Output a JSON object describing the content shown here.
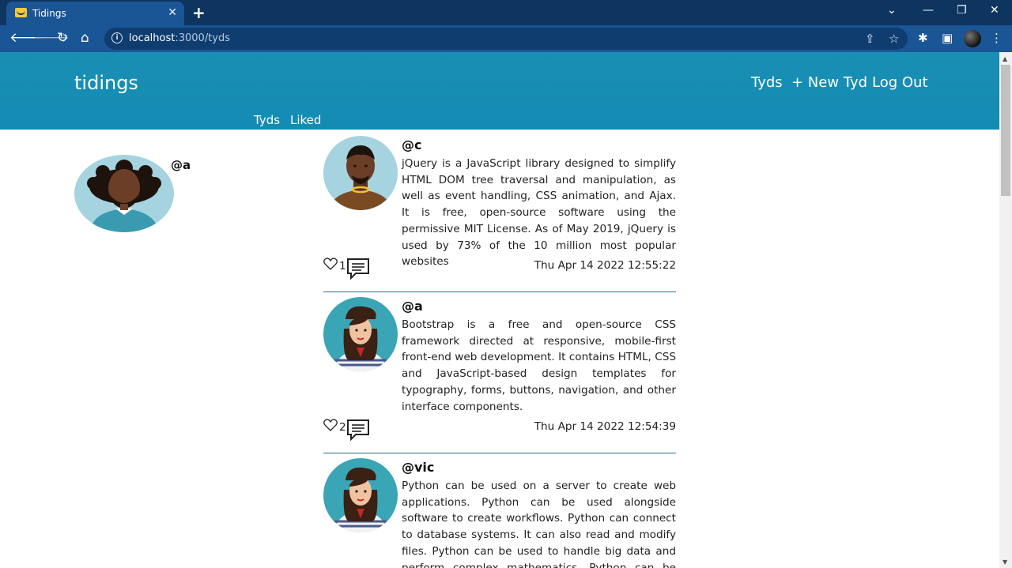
{
  "browser": {
    "tab_title": "Tidings",
    "tab_close": "✕",
    "new_tab": "+",
    "url_host": "localhost",
    "url_path": ":3000/tyds",
    "window_controls": [
      "minimize",
      "restore",
      "close"
    ]
  },
  "header": {
    "brand": "tidings",
    "nav": [
      "Tyds",
      "+ New Tyd",
      "Log Out"
    ],
    "sub_nav": [
      "Tyds",
      "Liked"
    ]
  },
  "profile": {
    "handle": "@a"
  },
  "posts": [
    {
      "handle": "@c",
      "text": "jQuery is a JavaScript library designed to simplify HTML DOM tree traversal and manipulation, as well as event handling, CSS animation, and Ajax. It is free, open-source software using the permissive MIT License. As of May 2019, jQuery is used by 73% of the 10 million most popular websites",
      "likes": "1",
      "timestamp": "Thu Apr 14 2022 12:55:22"
    },
    {
      "handle": "@a",
      "text": "Bootstrap is a free and open-source CSS framework directed at responsive, mobile-first front-end web development. It contains HTML, CSS and JavaScript-based design templates for typography, forms, buttons, navigation, and other interface components.",
      "likes": "2",
      "timestamp": "Thu Apr 14 2022 12:54:39"
    },
    {
      "handle": "@vic",
      "text": "Python can be used on a server to create web applications. Python can be used alongside software to create workflows. Python can connect to database systems. It can also read and modify files. Python can be used to handle big data and perform complex mathematics. Python can be used",
      "likes": "",
      "timestamp": ""
    }
  ],
  "colors": {
    "header_bg": "#1a8fb4",
    "divider": "#2a6f8f",
    "chrome_dark": "#0e3560",
    "chrome_toolbar": "#1a5596"
  }
}
